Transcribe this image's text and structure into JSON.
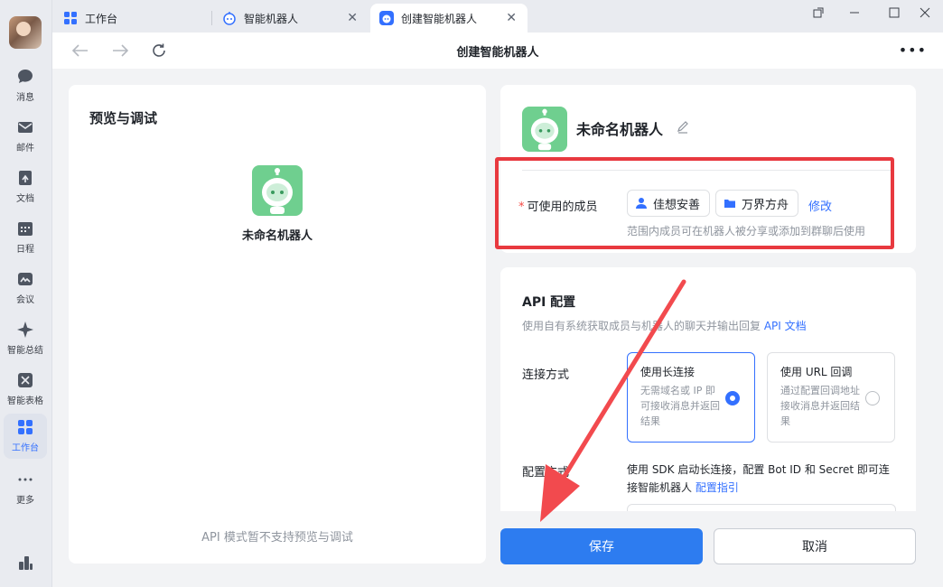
{
  "tabs": [
    {
      "label": "工作台"
    },
    {
      "label": "智能机器人"
    },
    {
      "label": "创建智能机器人"
    }
  ],
  "page_title": "创建智能机器人",
  "sidebar": {
    "items": [
      {
        "label": "消息"
      },
      {
        "label": "邮件"
      },
      {
        "label": "文档"
      },
      {
        "label": "日程"
      },
      {
        "label": "会议"
      },
      {
        "label": "智能总结"
      },
      {
        "label": "智能表格"
      },
      {
        "label": "工作台"
      },
      {
        "label": "更多"
      }
    ]
  },
  "preview": {
    "title": "预览与调试",
    "bot_name": "未命名机器人",
    "note": "API 模式暂不支持预览与调试"
  },
  "bot": {
    "name": "未命名机器人"
  },
  "members": {
    "label": "可使用的成员",
    "required_mark": "*",
    "chips": [
      "佳想安善",
      "万界方舟"
    ],
    "modify": "修改",
    "hint": "范围内成员可在机器人被分享或添加到群聊后使用"
  },
  "api": {
    "title": "API 配置",
    "desc": "使用自有系统获取成员与机器人的聊天并输出回复",
    "doc_link": "API 文档",
    "conn_label": "连接方式",
    "options": [
      {
        "title": "使用长连接",
        "desc": "无需域名或 IP 即可接收消息并返回结果",
        "selected": true
      },
      {
        "title": "使用 URL 回调",
        "desc": "通过配置回调地址接收消息并返回结果",
        "selected": false
      }
    ],
    "config_label": "配置方式",
    "config_text": "使用 SDK 启动长连接，配置 Bot ID 和 Secret 即可连接智能机器人",
    "config_link": "配置指引"
  },
  "buttons": {
    "save": "保存",
    "cancel": "取消"
  },
  "colors": {
    "accent": "#3370ff",
    "save_button": "#2d7cf0",
    "highlight": "#e8393f",
    "bot_avatar": "#6fcf8f"
  }
}
